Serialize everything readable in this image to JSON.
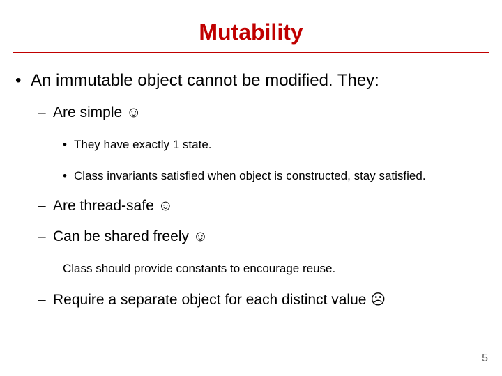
{
  "title": "Mutability",
  "bullets": {
    "l1": "An immutable object cannot be modified. They:",
    "l2a": "Are simple ☺",
    "l3a": "They have exactly 1 state.",
    "l3b": "Class invariants satisfied when object is constructed, stay satisfied.",
    "l2b": "Are thread-safe ☺",
    "l2c": "Can be shared freely ☺",
    "l3c": "Class should provide constants to encourage reuse.",
    "l2d": "Require a separate object for each distinct value ☹"
  },
  "page_number": "5",
  "glyphs": {
    "dot": "•",
    "dash": "–"
  }
}
